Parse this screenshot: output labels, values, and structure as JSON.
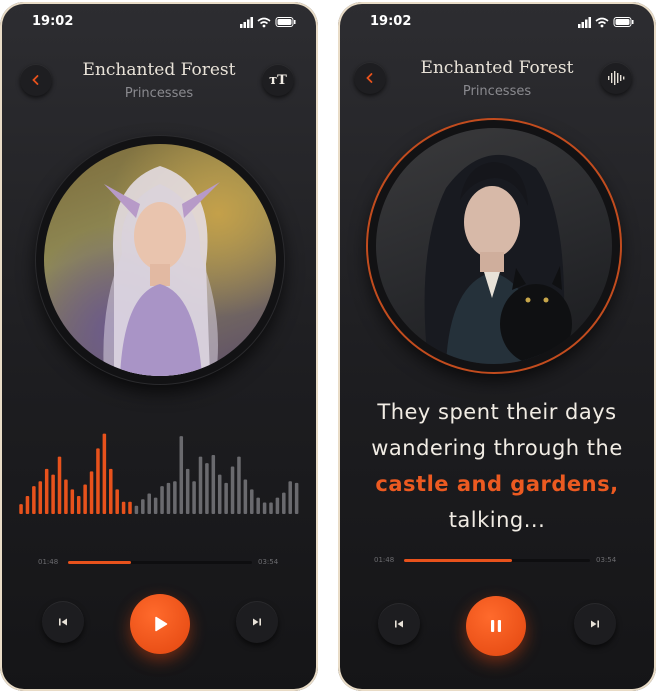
{
  "screens": [
    {
      "status_time": "19:02",
      "title": "Enchanted Forest",
      "subtitle": "Princesses",
      "right_action_label": "тT",
      "right_action_icon": "text-size-icon",
      "artwork": "elf-princess-portrait",
      "elapsed": "01:48",
      "duration": "03:54",
      "progress": 0.34,
      "play_state": "paused",
      "waveform_played_fraction": 0.42
    },
    {
      "status_time": "19:02",
      "title": "Enchanted Forest",
      "subtitle": "Princesses",
      "right_action_icon": "audio-wave-icon",
      "artwork": "dark-princess-with-cat-portrait",
      "lyric_before": "They spent their days wandering through the ",
      "lyric_highlight": "castle and gardens,",
      "lyric_after": " talking...",
      "elapsed": "01:48",
      "duration": "03:54",
      "progress": 0.58,
      "play_state": "playing"
    }
  ],
  "colors": {
    "accent": "#e8521c",
    "background": "#1d1d20",
    "text": "#e8e2d8",
    "muted": "#8a8a8f"
  }
}
